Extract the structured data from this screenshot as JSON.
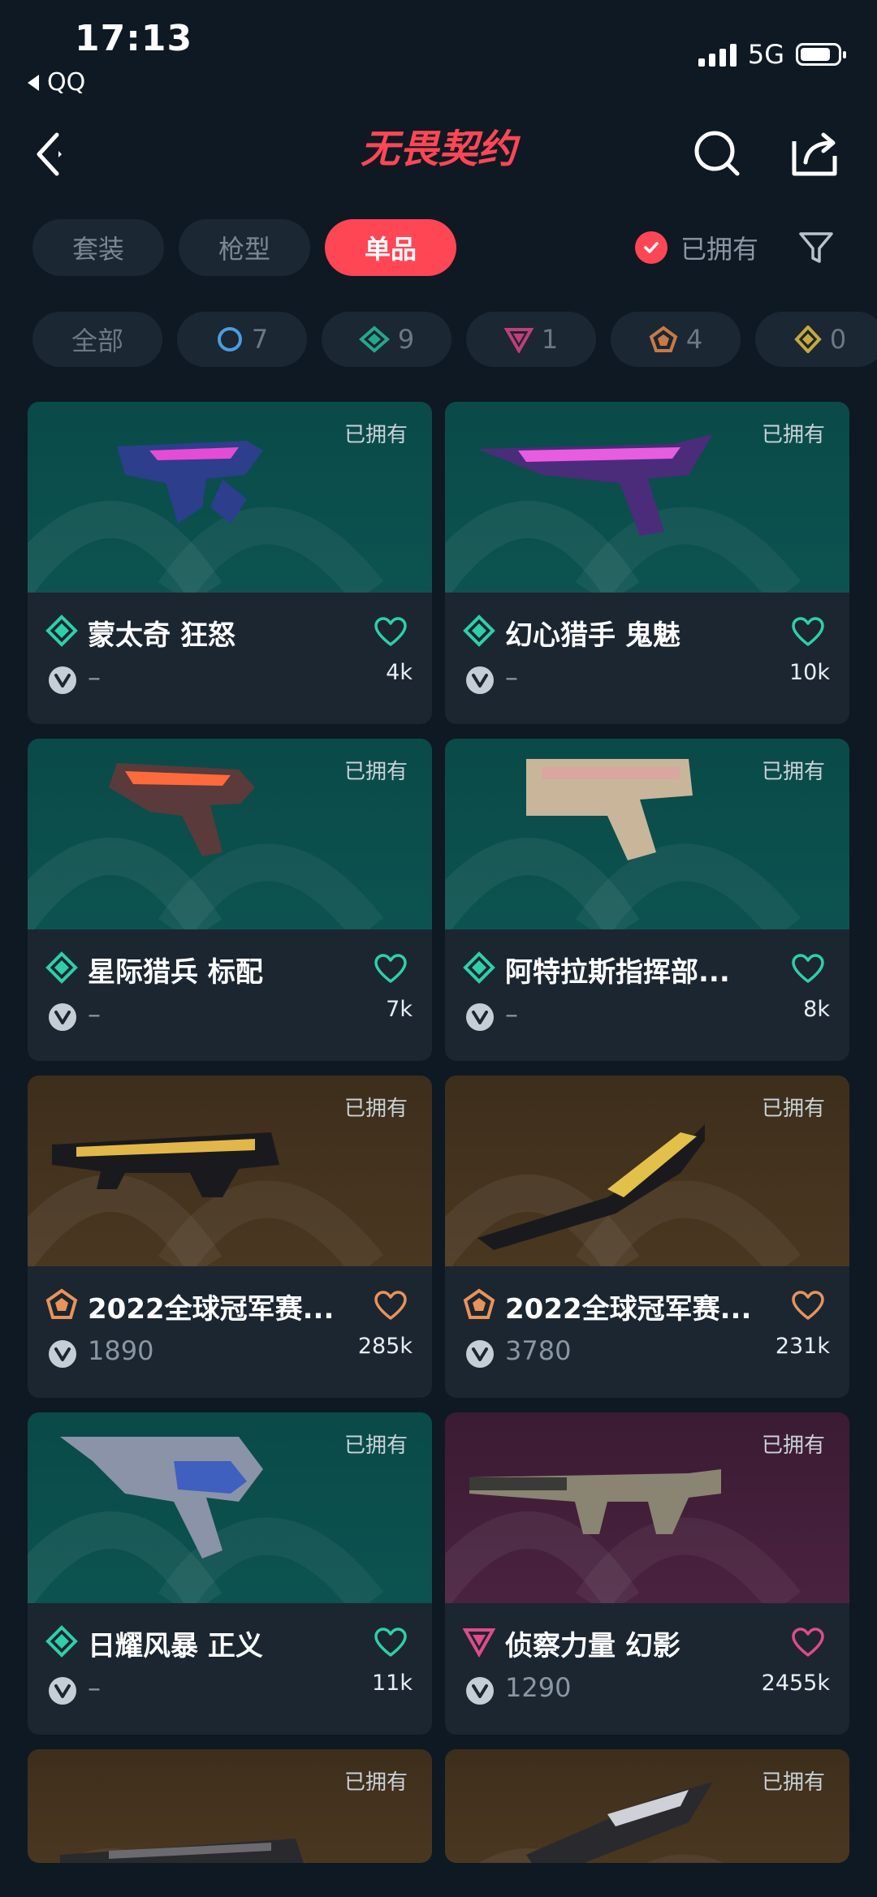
{
  "status_bar": {
    "time": "17:13",
    "back_app": "QQ",
    "network": "5G"
  },
  "header": {
    "logo_text": "无畏契约",
    "logo_color": "#ff4655"
  },
  "tabs": [
    {
      "label": "套装",
      "active": false
    },
    {
      "label": "枪型",
      "active": false
    },
    {
      "label": "单品",
      "active": true
    }
  ],
  "owned_filter": {
    "label": "已拥有",
    "checked": true
  },
  "tier_chips": [
    {
      "label": "全部",
      "icon": null,
      "count": ""
    },
    {
      "label": "",
      "icon": "circle-tier-icon",
      "count": "7"
    },
    {
      "label": "",
      "icon": "diamond-tier-icon",
      "count": "9"
    },
    {
      "label": "",
      "icon": "triangle-tier-icon",
      "count": "1"
    },
    {
      "label": "",
      "icon": "pentagon-tier-icon",
      "count": "4"
    },
    {
      "label": "",
      "icon": "rhombus-tier-icon",
      "count": "0"
    }
  ],
  "cards": [
    {
      "owned": "已拥有",
      "name": "蒙太奇 狂怒",
      "tier": "diamond",
      "tier_color": "#2fcfa8",
      "price": "–",
      "likes": "4k",
      "art": "teal"
    },
    {
      "owned": "已拥有",
      "name": "幻心猎手 鬼魅",
      "tier": "diamond",
      "tier_color": "#2fcfa8",
      "price": "–",
      "likes": "10k",
      "art": "teal"
    },
    {
      "owned": "已拥有",
      "name": "星际猎兵 标配",
      "tier": "diamond",
      "tier_color": "#2fcfa8",
      "price": "–",
      "likes": "7k",
      "art": "teal"
    },
    {
      "owned": "已拥有",
      "name": "阿特拉斯指挥部...",
      "tier": "diamond",
      "tier_color": "#2fcfa8",
      "price": "–",
      "likes": "8k",
      "art": "teal"
    },
    {
      "owned": "已拥有",
      "name": "2022全球冠军赛...",
      "tier": "pentagon",
      "tier_color": "#e9935a",
      "price": "1890",
      "likes": "285k",
      "art": "gold"
    },
    {
      "owned": "已拥有",
      "name": "2022全球冠军赛...",
      "tier": "pentagon",
      "tier_color": "#e9935a",
      "price": "3780",
      "likes": "231k",
      "art": "gold"
    },
    {
      "owned": "已拥有",
      "name": "日耀风暴 正义",
      "tier": "diamond",
      "tier_color": "#2fcfa8",
      "price": "–",
      "likes": "11k",
      "art": "teal"
    },
    {
      "owned": "已拥有",
      "name": "侦察力量 幻影",
      "tier": "triangle",
      "tier_color": "#e04b8a",
      "price": "1290",
      "likes": "2455k",
      "art": "pink"
    },
    {
      "owned": "已拥有",
      "name": "",
      "tier": "",
      "price": "",
      "likes": "",
      "art": "gold"
    },
    {
      "owned": "已拥有",
      "name": "",
      "tier": "",
      "price": "",
      "likes": "",
      "art": "gold"
    }
  ]
}
